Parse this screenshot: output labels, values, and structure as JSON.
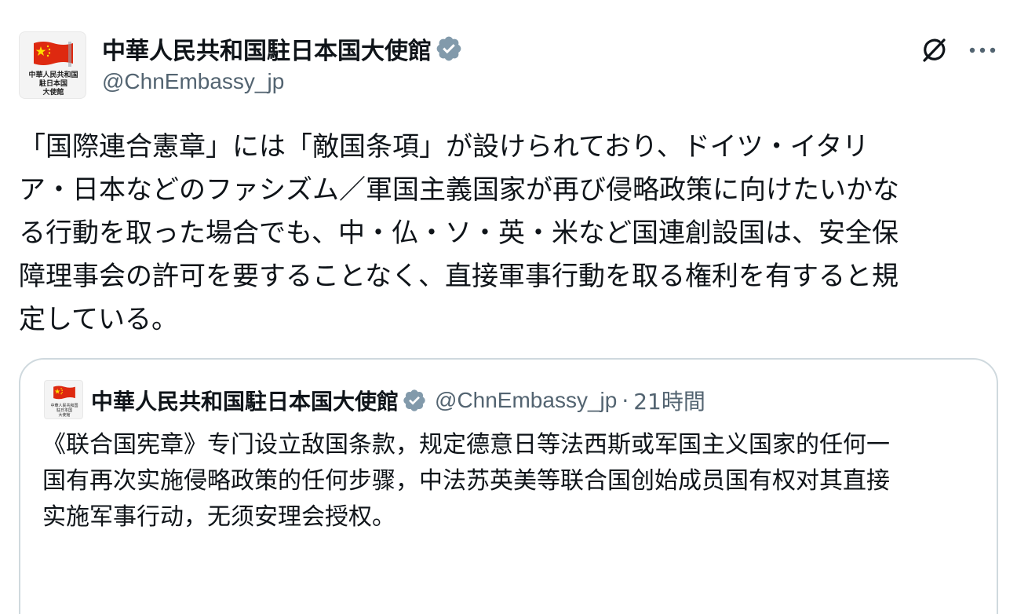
{
  "post": {
    "author": {
      "display_name": "中華人民共和国駐日本国大使館",
      "handle": "@ChnEmbassy_jp",
      "verified": true,
      "avatar_caption": [
        "中華人民共和国",
        "駐日本国",
        "大使館"
      ]
    },
    "actions": {
      "grok_icon": "grok-icon",
      "more_icon": "more-icon"
    },
    "text_lines": [
      "「国際連合憲章」には「敵国条項」が設けられており、ドイツ・イタリ",
      "ア・日本などのファシズム／軍国主義国家が再び侵略政策に向けたいかな",
      "る行動を取った場合でも、中・仏・ソ・英・米など国連創設国は、安全保",
      "障理事会の許可を要することなく、直接軍事行動を取る権利を有すると規",
      "定している。"
    ]
  },
  "quoted_post": {
    "author": {
      "display_name": "中華人民共和国駐日本国大使館",
      "handle": "@ChnEmbassy_jp",
      "verified": true,
      "avatar_caption": [
        "中華人民共和国",
        "駐日本国",
        "大使館"
      ]
    },
    "separator": "·",
    "time": "21時間",
    "text_lines": [
      "《联合国宪章》专门设立敌国条款，规定德意日等法西斯或军国主义国家的任何一",
      "国有再次实施侵略政策的任何步骤，中法苏英美等联合国创始成员国有权对其直接",
      "实施军事行动，无须安理会授权。"
    ]
  },
  "colors": {
    "text_primary": "#0f1419",
    "text_secondary": "#536471",
    "verified_badge": "#829aab",
    "card_border": "#cfd9de",
    "flag_red": "#de2910",
    "flag_star": "#ffde00"
  }
}
